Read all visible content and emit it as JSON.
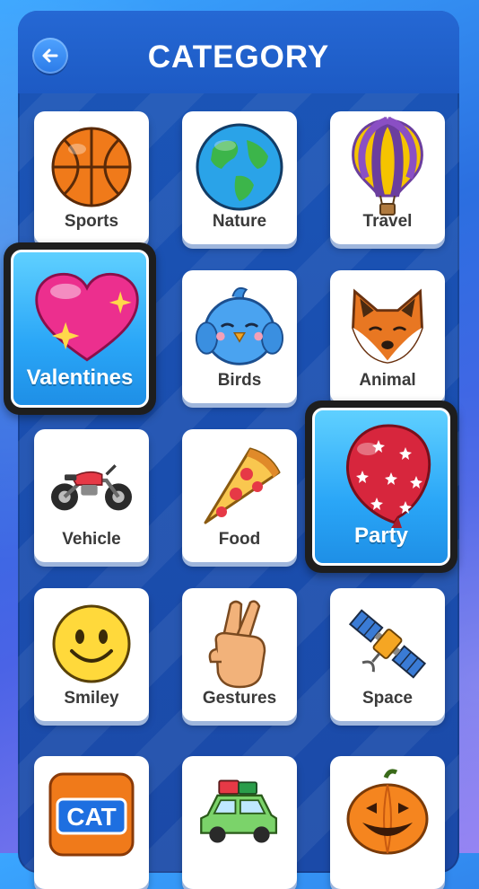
{
  "header": {
    "title": "CATEGORY"
  },
  "categories": [
    {
      "label": "Sports",
      "icon": "basketball-icon"
    },
    {
      "label": "Nature",
      "icon": "earth-globe-icon"
    },
    {
      "label": "Travel",
      "icon": "hot-air-balloon-icon"
    },
    {
      "label": "Valentines",
      "icon": "sparkling-heart-icon",
      "selected": true
    },
    {
      "label": "Birds",
      "icon": "bird-icon"
    },
    {
      "label": "Animal",
      "icon": "fox-icon"
    },
    {
      "label": "Vehicle",
      "icon": "motorcycle-icon"
    },
    {
      "label": "Food",
      "icon": "pizza-icon"
    },
    {
      "label": "Party",
      "icon": "balloon-icon",
      "selected": true
    },
    {
      "label": "Smiley",
      "icon": "smiley-face-icon"
    },
    {
      "label": "Gestures",
      "icon": "crossed-fingers-icon"
    },
    {
      "label": "Space",
      "icon": "satellite-icon"
    },
    {
      "label": "",
      "icon": "cat-word-tile-icon",
      "tile_text": "CAT"
    },
    {
      "label": "",
      "icon": "car-icon"
    },
    {
      "label": "",
      "icon": "jack-o-lantern-icon"
    }
  ],
  "colors": {
    "panel": "#1b56b8",
    "header": "#2568d4",
    "featured_bg": "#2aa6f7",
    "card_bg": "#ffffff",
    "label": "#3a3a3a"
  }
}
